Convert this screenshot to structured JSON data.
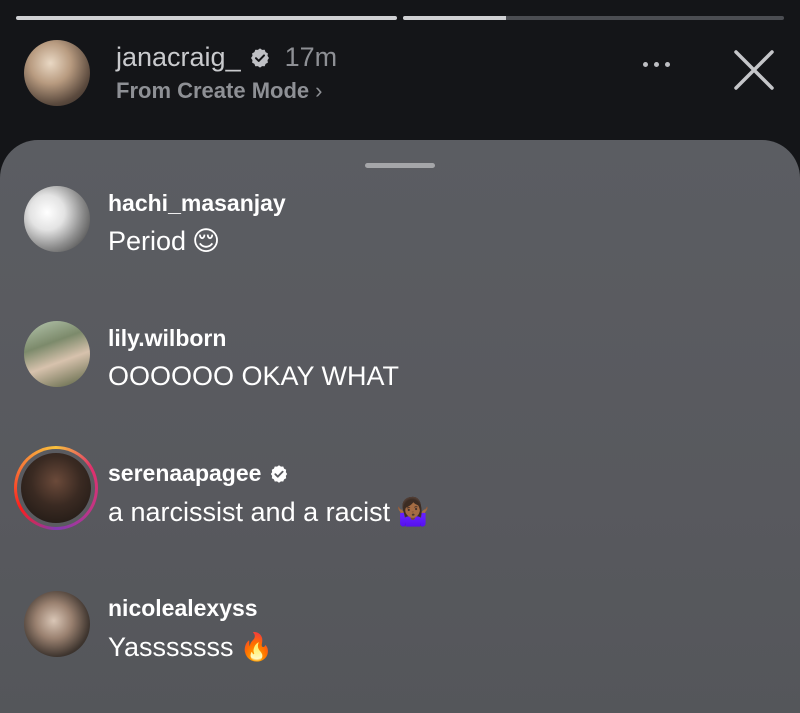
{
  "progress": [
    {
      "fill": 1.0
    },
    {
      "fill": 0.27
    }
  ],
  "header": {
    "username": "janacraig_",
    "time": "17m",
    "subtitle": "From Create Mode",
    "subtitle_chevron": "›",
    "verified_icon": "verified-badge-icon",
    "more_icon": "more-horizontal-icon",
    "close_icon": "close-icon"
  },
  "comments": [
    {
      "username": "hachi_masanjay",
      "verified": false,
      "text": "Period",
      "emoji": "😌"
    },
    {
      "username": "lily.wilborn",
      "verified": false,
      "text": "OOOOOO OKAY WHAT",
      "emoji": ""
    },
    {
      "username": "serenaapagee",
      "verified": true,
      "text": "a narcissist and a racist",
      "emoji": "🤷🏾‍♀️"
    },
    {
      "username": "nicolealexyss",
      "verified": false,
      "text": "Yasssssss",
      "emoji": "🔥"
    }
  ],
  "colors": {
    "background": "#141518",
    "sheet": "#5a5b60",
    "verified": "#ffffff"
  }
}
